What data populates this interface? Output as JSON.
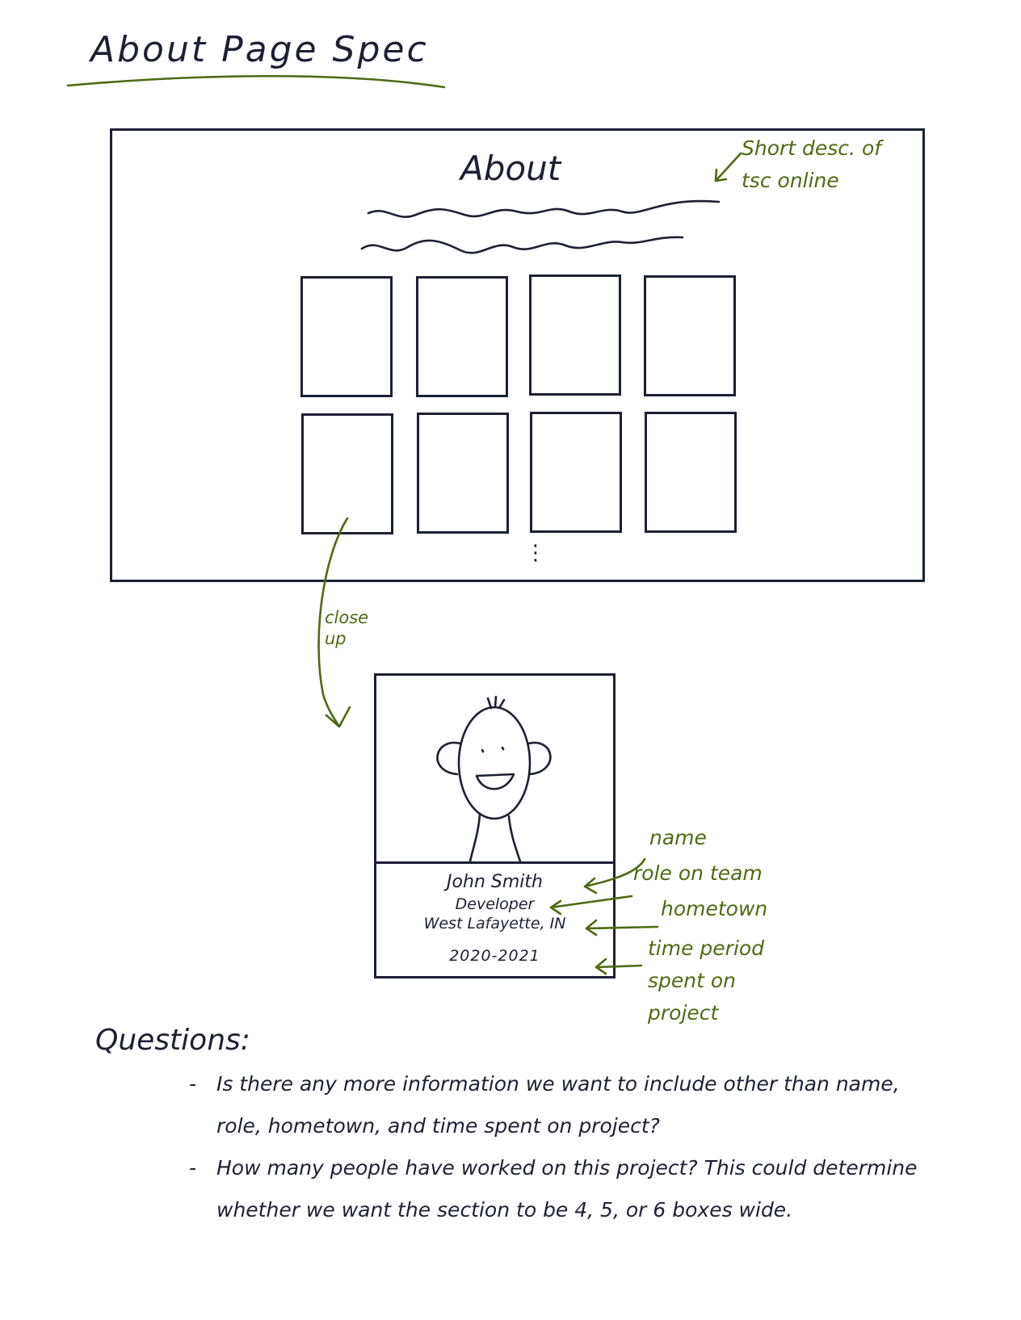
{
  "page": {
    "title": "About Page Spec"
  },
  "wireframe": {
    "heading": "About",
    "tile_count": 8,
    "ellipsis": "⋮"
  },
  "annotations": {
    "description_note": "Short desc. of tsc online",
    "close_up": "close up",
    "name": "name",
    "role": "role on team",
    "hometown": "hometown",
    "time_period": "time period spent on project"
  },
  "card": {
    "name": "John Smith",
    "role": "Developer",
    "hometown": "West Lafayette, IN",
    "years": "2020-2021"
  },
  "questions": {
    "heading": "Questions:",
    "items": [
      "Is there any more information we want to include other than name, role, hometown, and time spent on project?",
      "How many people have worked on this project? This could determine whether we want the section to be 4, 5, or 6 boxes wide."
    ]
  },
  "colors": {
    "ink": "#1c2033",
    "annotation": "#4e6a14"
  }
}
